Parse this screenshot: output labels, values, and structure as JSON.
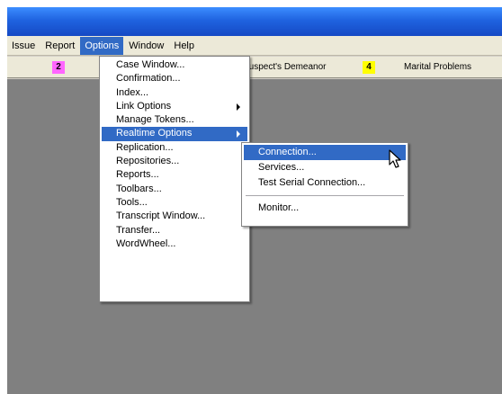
{
  "menubar": {
    "items": [
      "Issue",
      "Report",
      "Options",
      "Window",
      "Help"
    ]
  },
  "tabs": [
    {
      "number": "2",
      "chip_color": "#ff66ff",
      "label": ""
    },
    {
      "number": "",
      "chip_color": "",
      "label": "Suspect's Demeanor"
    },
    {
      "number": "4",
      "chip_color": "#ffff00",
      "label": "Marital Problems"
    }
  ],
  "options_menu": {
    "items": [
      {
        "label": "Case Window..."
      },
      {
        "label": "Confirmation..."
      },
      {
        "label": "Index..."
      },
      {
        "label": "Link Options",
        "submenu": true
      },
      {
        "label": "Manage Tokens..."
      },
      {
        "label": "Realtime Options",
        "submenu": true,
        "highlighted": true
      },
      {
        "label": "Replication..."
      },
      {
        "label": "Repositories..."
      },
      {
        "label": "Reports..."
      },
      {
        "label": "Toolbars..."
      },
      {
        "label": "Tools..."
      },
      {
        "label": "Transcript Window..."
      },
      {
        "label": "Transfer..."
      },
      {
        "label": "WordWheel..."
      }
    ]
  },
  "realtime_submenu": {
    "items": [
      {
        "label": "Connection...",
        "highlighted": true
      },
      {
        "label": "Services..."
      },
      {
        "label": "Test Serial Connection..."
      },
      {
        "label": "Monitor..."
      }
    ]
  },
  "colors": {
    "titlebar": "#1f63e0",
    "highlight": "#316ac5",
    "workspace": "#808080"
  }
}
